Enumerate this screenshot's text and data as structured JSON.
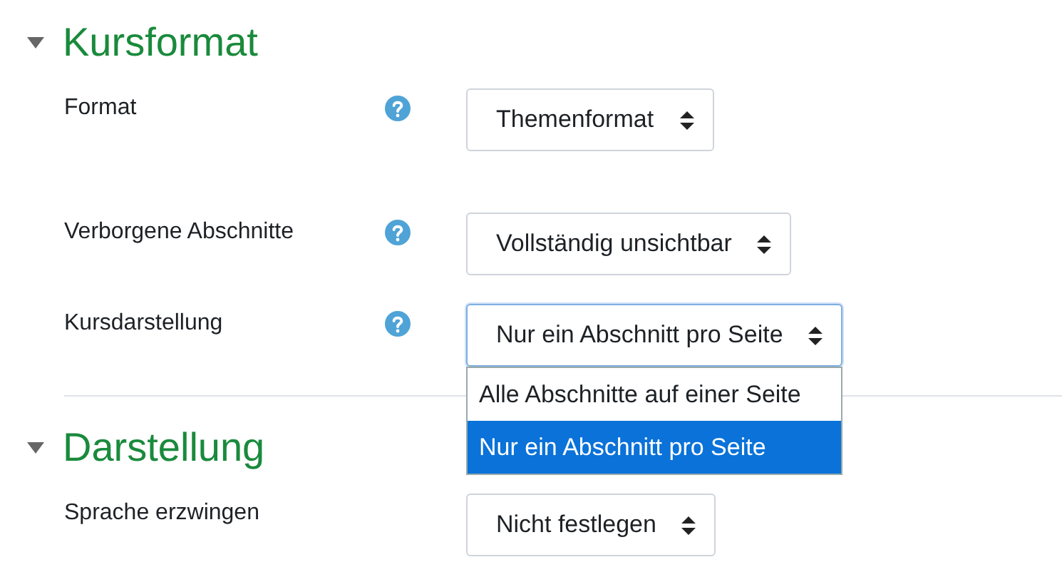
{
  "sections": [
    {
      "title": "Kursformat",
      "expanded": true,
      "rows": [
        {
          "label": "Format",
          "help": true,
          "value": "Themenformat",
          "open": false
        },
        {
          "label": "Verborgene Abschnitte",
          "help": true,
          "value": "Vollständig unsichtbar",
          "open": false
        },
        {
          "label": "Kursdarstellung",
          "help": true,
          "value": "Nur ein Abschnitt pro Seite",
          "open": true,
          "options": [
            {
              "label": "Alle Abschnitte auf einer Seite",
              "selected": false
            },
            {
              "label": "Nur ein Abschnitt pro Seite",
              "selected": true
            }
          ]
        }
      ]
    },
    {
      "title": "Darstellung",
      "expanded": true,
      "rows": [
        {
          "label": "Sprache erzwingen",
          "help": false,
          "value": "Nicht festlegen",
          "open": false
        }
      ]
    }
  ]
}
